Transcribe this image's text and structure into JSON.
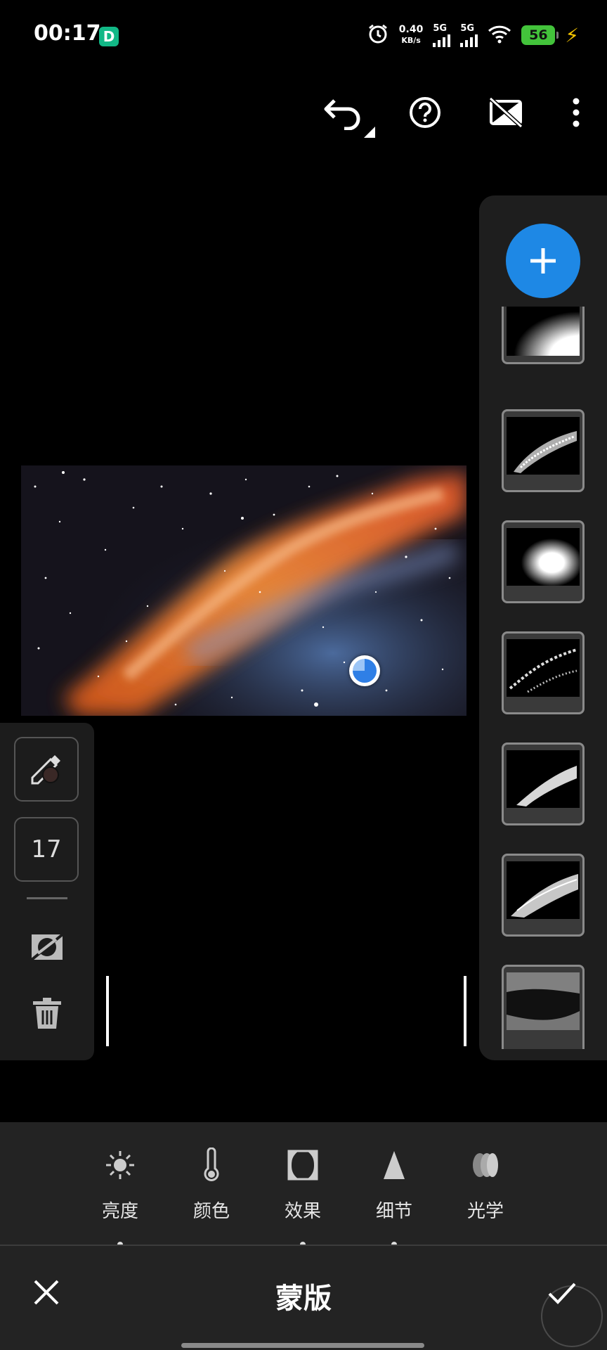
{
  "status_bar": {
    "time": "00:17",
    "app_badge": "D",
    "net_speed_value": "0.40",
    "net_speed_unit": "KB/s",
    "sim1_label": "5G",
    "sim2_label": "5G",
    "battery_level": "56"
  },
  "mask_panel": {
    "mask_count": 7
  },
  "left_tools": {
    "brush_size": "17"
  },
  "categories": [
    {
      "label": "亮度",
      "icon": "brightness-icon"
    },
    {
      "label": "颜色",
      "icon": "thermometer-icon"
    },
    {
      "label": "效果",
      "icon": "vignette-icon"
    },
    {
      "label": "细节",
      "icon": "triangle-icon"
    },
    {
      "label": "光学",
      "icon": "lens-icon"
    }
  ],
  "bottom_bar": {
    "title": "蒙版"
  },
  "colors": {
    "accent": "#1e88e5",
    "panel": "#1e1e1e",
    "battery": "#43c33b"
  }
}
